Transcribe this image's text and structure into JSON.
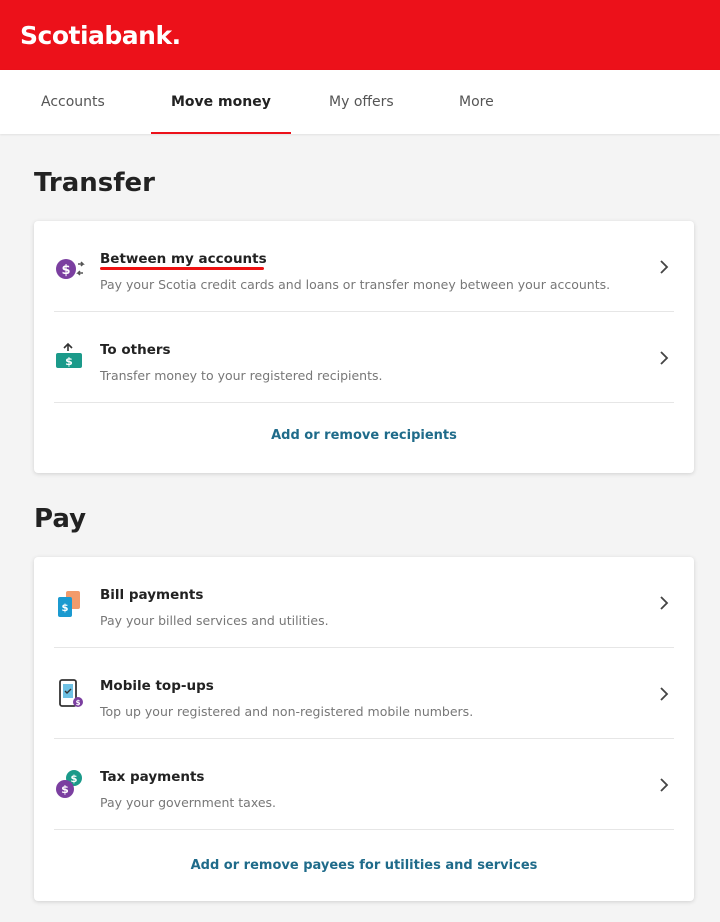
{
  "header": {
    "brand": "Scotiabank."
  },
  "tabs": [
    {
      "label": "Accounts",
      "active": false
    },
    {
      "label": "Move money",
      "active": true
    },
    {
      "label": "My offers",
      "active": false
    },
    {
      "label": "More",
      "active": false
    }
  ],
  "transfer": {
    "title": "Transfer",
    "items": [
      {
        "title": "Between my accounts",
        "desc": "Pay your Scotia credit cards and loans or transfer money between your accounts.",
        "icon": "exchange-dollar-icon"
      },
      {
        "title": "To others",
        "desc": "Transfer money to your registered recipients.",
        "icon": "send-money-icon"
      }
    ],
    "link": "Add or remove recipients"
  },
  "pay": {
    "title": "Pay",
    "items": [
      {
        "title": "Bill payments",
        "desc": "Pay your billed services and utilities.",
        "icon": "bill-icon"
      },
      {
        "title": "Mobile top-ups",
        "desc": "Top up your registered and non-registered mobile numbers.",
        "icon": "mobile-icon"
      },
      {
        "title": "Tax payments",
        "desc": "Pay your government taxes.",
        "icon": "tax-coins-icon"
      }
    ],
    "link": "Add or remove payees for utilities and services"
  },
  "colors": {
    "brand": "#ec111a",
    "link": "#1f6b8a",
    "icon_purple": "#7b3fa0",
    "icon_teal": "#1b9a8a"
  }
}
